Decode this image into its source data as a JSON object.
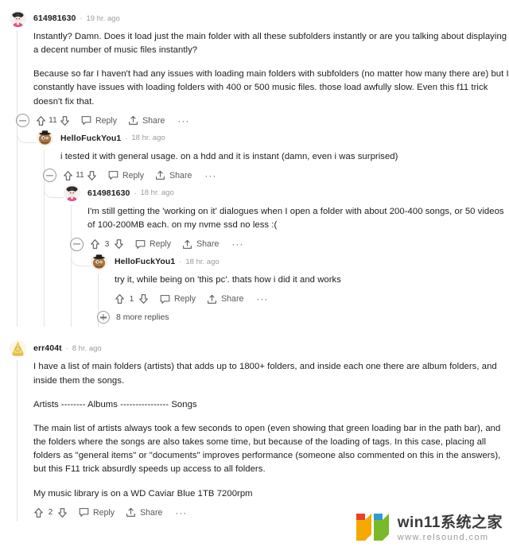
{
  "thread": {
    "comments": [
      {
        "id": "c0",
        "depth": 0,
        "author": "614981630",
        "separator": "·",
        "timestamp": "19 hr. ago",
        "avatar": "avatar-dark-hair-pink",
        "paragraphs": [
          "Instantly? Damn. Does it load just the main folder with all these subfolders instantly or are you talking about displaying a decent number of music files instantly?",
          "Because so far I haven't had any issues with loading main folders with subfolders (no matter how many there are) but I constantly have issues with loading folders with 400 or 500 music files. those load awfully slow. Even this f11 trick doesn't fix that."
        ],
        "has_collapse": true,
        "score": "11",
        "reply_label": "Reply",
        "share_label": "Share",
        "more_label": "···"
      },
      {
        "id": "c1",
        "depth": 1,
        "author": "HelloFuckYou1",
        "separator": "·",
        "timestamp": "18 hr. ago",
        "avatar": "avatar-tophat-brown",
        "paragraphs": [
          "i tested it with general usage. on a hdd and it is instant (damn, even i was surprised)"
        ],
        "has_collapse": true,
        "score": "11",
        "reply_label": "Reply",
        "share_label": "Share",
        "more_label": "···"
      },
      {
        "id": "c2",
        "depth": 2,
        "author": "614981630",
        "separator": "·",
        "timestamp": "18 hr. ago",
        "avatar": "avatar-dark-hair-pink",
        "paragraphs": [
          "I'm still getting the 'working on it' dialogues when I open a folder with about 200-400 songs, or 50 videos of 100-200MB each. on my nvme ssd no less :("
        ],
        "has_collapse": true,
        "score": "3",
        "reply_label": "Reply",
        "share_label": "Share",
        "more_label": "···"
      },
      {
        "id": "c3",
        "depth": 3,
        "author": "HelloFuckYou1",
        "separator": "·",
        "timestamp": "18 hr. ago",
        "avatar": "avatar-tophat-brown",
        "paragraphs": [
          "try it, while being on 'this pc'. thats how i did it and works"
        ],
        "has_collapse": false,
        "score": "1",
        "reply_label": "Reply",
        "share_label": "Share",
        "more_label": "···"
      }
    ],
    "more_replies_label": "8 more replies",
    "last_comment": {
      "id": "c4",
      "depth": 0,
      "author": "err404t",
      "separator": "·",
      "timestamp": "8 hr. ago",
      "avatar": "avatar-gold",
      "paragraphs": [
        "I have a list of main folders (artists) that adds up to 1800+ folders, and inside each one there are album folders, and inside them the songs.",
        "Artists -------- Albums ---------------- Songs",
        "The main list of artists always took a few seconds to open (even showing that green loading bar in the path bar), and the folders where the songs are also takes some time, but because of the loading of tags. In this case, placing all folders as \"general items\" or \"documents\" improves performance (someone also commented on this in the answers), but this F11 trick absurdly speeds up access to all folders.",
        "My music library is on a WD Caviar Blue 1TB 7200rpm"
      ],
      "has_collapse": false,
      "score": "2",
      "reply_label": "Reply",
      "share_label": "Share",
      "more_label": "···"
    }
  },
  "watermark": {
    "title": "win11系统之家",
    "url": "www.relsound.com",
    "colors": {
      "red": "#e8402a",
      "blue": "#2e9bd6",
      "orange": "#f5a800",
      "green": "#7ab929"
    }
  },
  "colors": {
    "text": "#1c1c1c",
    "meta": "#9b9b9b",
    "action": "#5a5a5a",
    "threadline": "#e3e3e3",
    "background": "#ffffff"
  }
}
